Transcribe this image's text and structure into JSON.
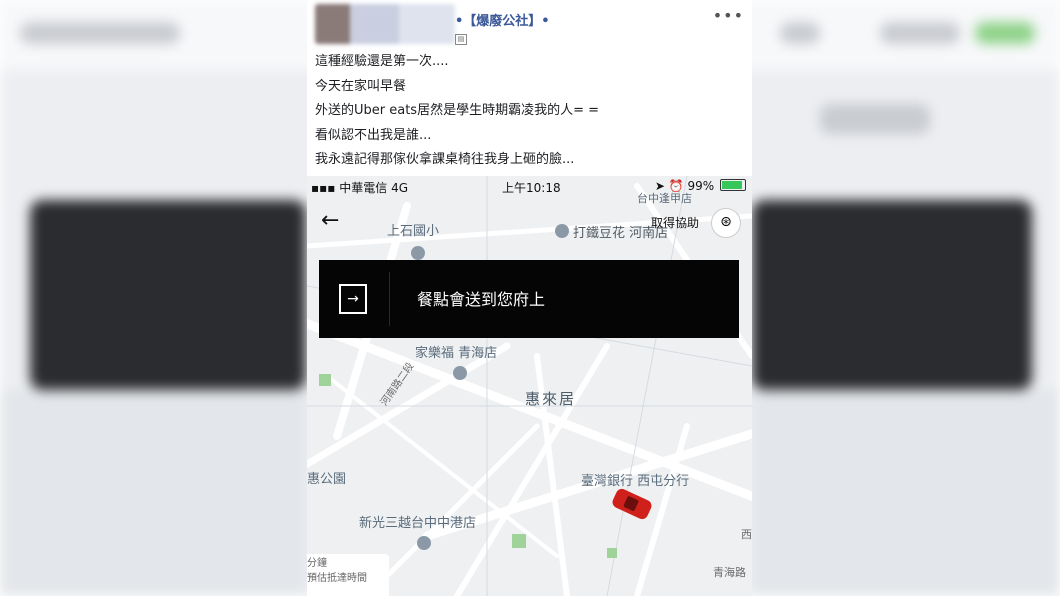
{
  "post": {
    "group_name": "•【爆廢公社】•",
    "more": "•••",
    "lines": [
      "這種經驗還是第一次....",
      "今天在家叫早餐",
      "外送的Uber eats居然是學生時期霸凌我的人= =",
      "看似認不出我是誰...",
      "我永遠記得那傢伙拿課桌椅往我身上砸的臉..."
    ]
  },
  "phone": {
    "status": {
      "carrier": "中華電信",
      "network": "4G",
      "time": "上午10:18",
      "battery": "99%"
    },
    "help_label": "取得協助",
    "banner_text": "餐點會送到您府上",
    "eta": {
      "line1": "分鐘",
      "line2": "預估抵達時間"
    },
    "map_labels": {
      "school": "上石國小",
      "tofu": "打鐵豆花 河南店",
      "zhongxin": "台中逢甲店",
      "carrefour": "家樂福 青海店",
      "huilai": "惠來居",
      "bank": "臺灣銀行 西屯分行",
      "park": "惠公園",
      "mitsukoshi": "新光三越台中中港店",
      "qinghai_road": "青海路",
      "henan_road": "河南路二段",
      "xi": "西"
    }
  },
  "colors": {
    "fb_blue": "#3b5998",
    "banner_bg": "#050505",
    "car": "#d0201c",
    "map_bg": "#eef0f2"
  }
}
